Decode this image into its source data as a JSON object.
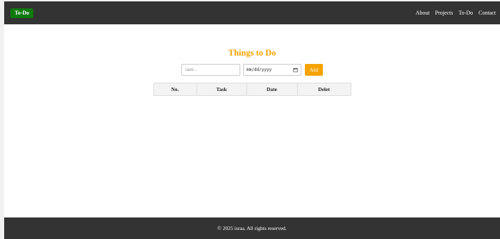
{
  "navbar": {
    "brand": "To-Do",
    "links": [
      "About",
      "Projects",
      "To-Do",
      "Contact"
    ]
  },
  "main": {
    "title": "Things to Do",
    "form": {
      "task_placeholder": "Task...",
      "date_placeholder": "mm/dd/yyyy",
      "add_label": "Add"
    },
    "table": {
      "headers": [
        "No.",
        "Task",
        "Date",
        "Delet"
      ]
    }
  },
  "footer": {
    "text": "© 2025 israa. All rights reserved."
  },
  "colors": {
    "navbar_bg": "#333333",
    "brand_bg": "#0e7a0e",
    "accent": "#f5a300",
    "footer_bg": "#333333"
  },
  "icons": {
    "date_picker": "calendar-icon"
  }
}
